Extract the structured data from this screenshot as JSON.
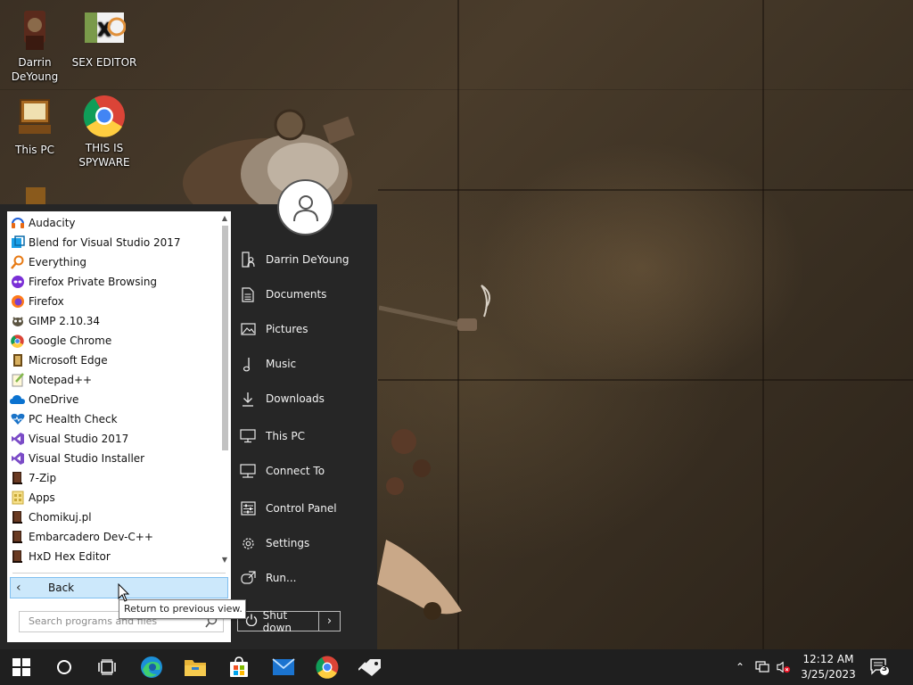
{
  "desktop": {
    "icons": [
      {
        "label": "Darrin DeYoung",
        "icon": "user-folder-icon"
      },
      {
        "label": "SEX EDITOR",
        "icon": "hxd-icon"
      },
      {
        "label": "This PC",
        "icon": "this-pc-icon"
      },
      {
        "label": "THIS IS SPYWARE",
        "icon": "chrome-icon"
      }
    ]
  },
  "start_menu": {
    "programs": [
      {
        "label": "Audacity",
        "icon": "audacity-icon",
        "color": "#1f5fd6"
      },
      {
        "label": "Blend for Visual Studio 2017",
        "icon": "blend-icon",
        "color": "#1aa0e8"
      },
      {
        "label": "Everything",
        "icon": "everything-icon",
        "color": "#e77a14"
      },
      {
        "label": "Firefox Private Browsing",
        "icon": "firefox-private-icon",
        "color": "#7a2fd6"
      },
      {
        "label": "Firefox",
        "icon": "firefox-icon",
        "color": "#ff7a1a"
      },
      {
        "label": "GIMP 2.10.34",
        "icon": "gimp-icon",
        "color": "#5c5543"
      },
      {
        "label": "Google Chrome",
        "icon": "chrome-icon",
        "color": "#db4437"
      },
      {
        "label": "Microsoft Edge",
        "icon": "edge-icon",
        "color": "#6b4a16"
      },
      {
        "label": "Notepad++",
        "icon": "notepadpp-icon",
        "color": "#84b84c"
      },
      {
        "label": "OneDrive",
        "icon": "onedrive-icon",
        "color": "#0a72d0"
      },
      {
        "label": "PC Health Check",
        "icon": "pc-health-icon",
        "color": "#1a73c8"
      },
      {
        "label": "Visual Studio 2017",
        "icon": "visual-studio-icon",
        "color": "#7b4cc7"
      },
      {
        "label": "Visual Studio Installer",
        "icon": "vs-installer-icon",
        "color": "#7b4cc7"
      },
      {
        "label": "7-Zip",
        "icon": "folder-book-icon",
        "color": "#3a1f12"
      },
      {
        "label": "Apps",
        "icon": "apps-folder-icon",
        "color": "#e6c24a"
      },
      {
        "label": "Chomikuj.pl",
        "icon": "folder-book-icon",
        "color": "#3a1f12"
      },
      {
        "label": "Embarcadero Dev-C++",
        "icon": "folder-book-icon",
        "color": "#3a1f12"
      },
      {
        "label": "HxD Hex Editor",
        "icon": "folder-book-icon",
        "color": "#3a1f12"
      }
    ],
    "back_label": "Back",
    "search_placeholder": "Search programs and files",
    "tooltip": "Return to previous view.",
    "places": [
      {
        "label": "Darrin DeYoung",
        "icon": "user-folder-icon"
      },
      {
        "label": "Documents",
        "icon": "documents-icon"
      },
      {
        "label": "Pictures",
        "icon": "pictures-icon"
      },
      {
        "label": "Music",
        "icon": "music-icon"
      },
      {
        "label": "Downloads",
        "icon": "downloads-icon"
      },
      {
        "label": "This PC",
        "icon": "computer-icon"
      },
      {
        "label": "Connect To",
        "icon": "connect-icon"
      },
      {
        "label": "Control Panel",
        "icon": "control-panel-icon"
      },
      {
        "label": "Settings",
        "icon": "gear-icon"
      },
      {
        "label": "Run...",
        "icon": "run-icon"
      }
    ],
    "shutdown_label": "Shut down"
  },
  "taskbar": {
    "apps": [
      "windows-start-icon",
      "cortana-icon",
      "task-view-icon",
      "edge-icon",
      "file-explorer-icon",
      "microsoft-store-icon",
      "mail-icon",
      "chrome-icon",
      "tag-app-icon"
    ],
    "time": "12:12 AM",
    "date": "3/25/2023",
    "notifications_count": "3"
  },
  "colors": {
    "menu_bg": "#262626",
    "taskbar_bg": "#1f1f1f",
    "highlight": "#cce8fb"
  }
}
